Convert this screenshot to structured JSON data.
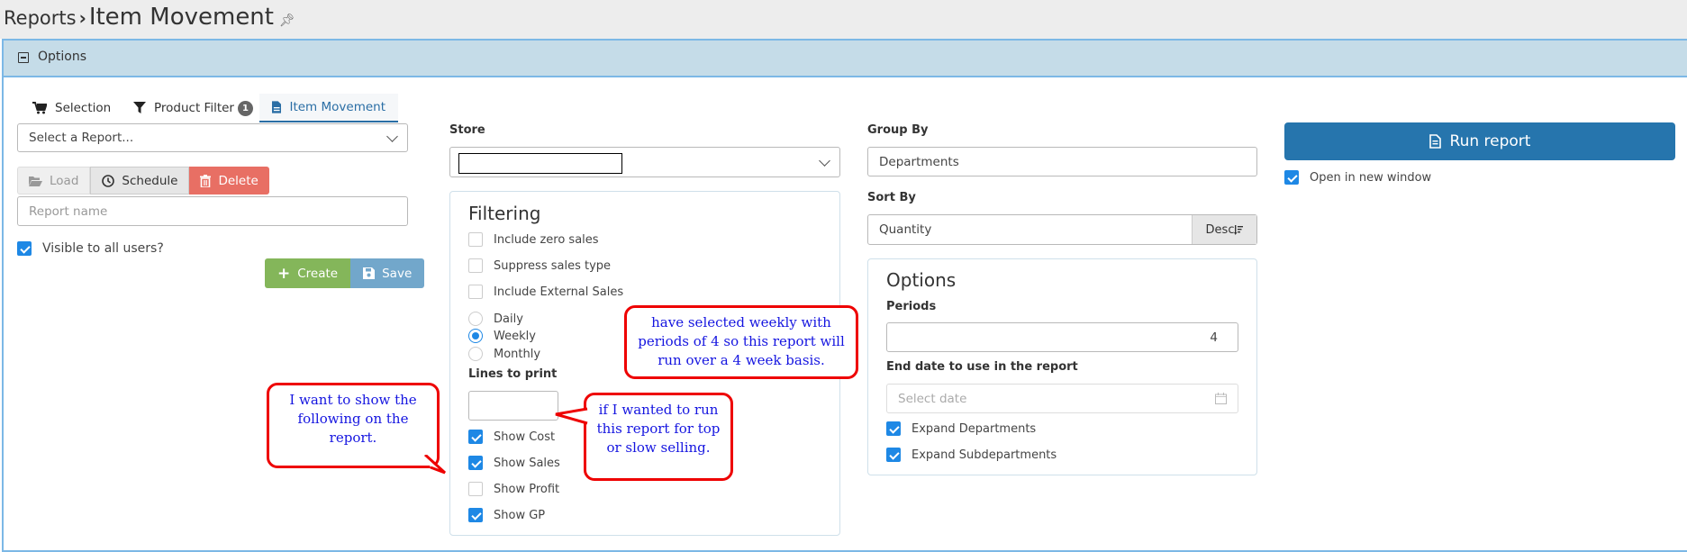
{
  "header": {
    "breadcrumb_root": "Reports",
    "breadcrumb_separator": "›",
    "title": "Item Movement",
    "pin_icon": "pin-icon"
  },
  "options_bar": {
    "label": "Options",
    "collapse_icon": "minus-square-icon"
  },
  "tabs": [
    {
      "label": "Selection",
      "icon": "cart-icon"
    },
    {
      "label": "Product Filter",
      "icon": "filter-icon",
      "badge": "1"
    },
    {
      "label": "Item Movement",
      "icon": "file-icon",
      "active": true
    }
  ],
  "saved_reports": {
    "select_placeholder": "Select a Report...",
    "load_label": "Load",
    "schedule_label": "Schedule",
    "delete_label": "Delete",
    "report_name_placeholder": "Report name",
    "visible_label": "Visible to all users?",
    "visible_checked": true,
    "create_label": "Create",
    "save_label": "Save"
  },
  "store": {
    "label": "Store",
    "value": ""
  },
  "filtering": {
    "title": "Filtering",
    "checkboxes": [
      {
        "label": "Include zero sales",
        "checked": false
      },
      {
        "label": "Suppress sales type",
        "checked": false
      },
      {
        "label": "Include External Sales",
        "checked": false
      }
    ],
    "period_options": [
      {
        "label": "Daily",
        "selected": false
      },
      {
        "label": "Weekly",
        "selected": true
      },
      {
        "label": "Monthly",
        "selected": false
      }
    ],
    "lines_to_print_label": "Lines to print",
    "lines_to_print_value": "",
    "show_options": [
      {
        "label": "Show Cost",
        "checked": true
      },
      {
        "label": "Show Sales",
        "checked": true
      },
      {
        "label": "Show Profit",
        "checked": false
      },
      {
        "label": "Show GP",
        "checked": true
      }
    ]
  },
  "group_by": {
    "label": "Group By",
    "value": "Departments"
  },
  "sort_by": {
    "label": "Sort By",
    "value": "Quantity",
    "direction_label": "Desc"
  },
  "options_panel": {
    "title": "Options",
    "periods_label": "Periods",
    "periods_value": "4",
    "end_date_label": "End date to use in the report",
    "end_date_placeholder": "Select date",
    "expand_departments_label": "Expand Departments",
    "expand_departments_checked": true,
    "expand_subdepartments_label": "Expand Subdepartments",
    "expand_subdepartments_checked": true
  },
  "run": {
    "label": "Run report",
    "open_new_window_label": "Open in new window",
    "open_new_window_checked": true
  },
  "annotations": {
    "show_note": "I want to show the following on the report.",
    "lines_note": "if I wanted to run this report for top or slow selling.",
    "periods_note": "have selected weekly with periods of 4 so this report will run over a 4 week basis."
  },
  "colors": {
    "primary": "#2675ad",
    "danger": "#e86f64",
    "success": "#84b65a",
    "info": "#72a7cb",
    "checkbox": "#1e88e5",
    "annotation_border": "#ee0000",
    "annotation_text": "#1515e0"
  }
}
